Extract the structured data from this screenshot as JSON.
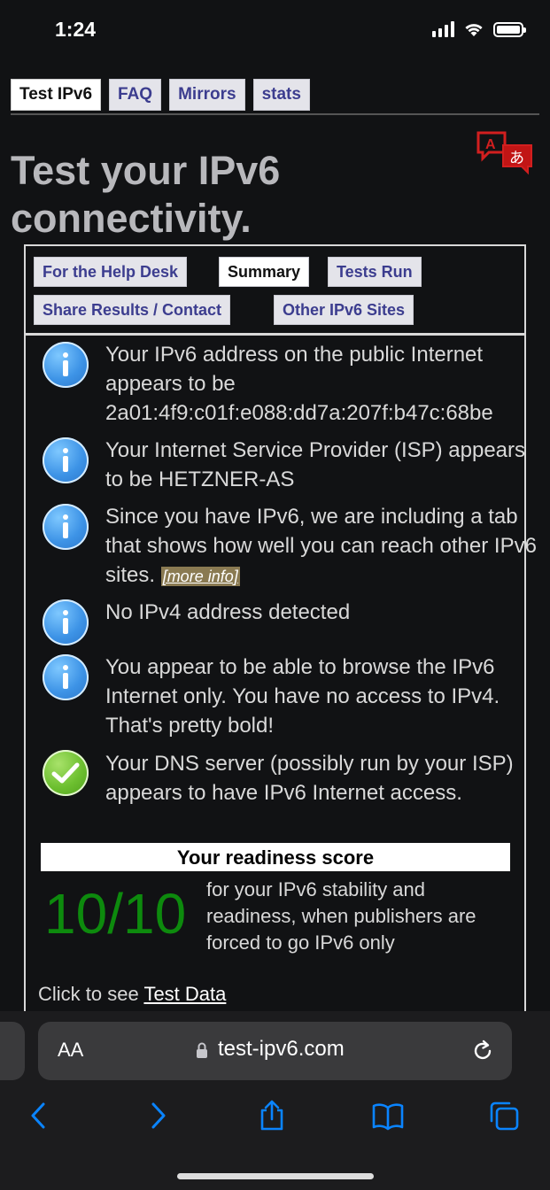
{
  "status": {
    "time": "1:24"
  },
  "nav": {
    "tabs": [
      {
        "label": "Test IPv6",
        "active": true
      },
      {
        "label": "FAQ"
      },
      {
        "label": "Mirrors"
      },
      {
        "label": "stats"
      }
    ]
  },
  "page": {
    "title": "Test your IPv6 connectivity."
  },
  "subnav": {
    "tabs": [
      {
        "label": "For the Help Desk"
      },
      {
        "label": "Summary",
        "active": true
      },
      {
        "label": "Tests Run"
      },
      {
        "label": "Share Results / Contact"
      },
      {
        "label": "Other IPv6 Sites"
      }
    ]
  },
  "results": [
    {
      "icon": "info-icon",
      "text": "Your IPv6 address on the public Internet appears to be 2a01:4f9:c01f:e088:dd7a:207f:b47c:68be"
    },
    {
      "icon": "info-icon",
      "text": "Your Internet Service Provider (ISP) appears to be HETZNER-AS"
    },
    {
      "icon": "info-icon",
      "text": "Since you have IPv6, we are including a tab that shows how well you can reach other IPv6 sites.",
      "link": "[more info]"
    },
    {
      "icon": "info-icon",
      "text": "No IPv4 address detected"
    },
    {
      "icon": "info-icon",
      "text": "You appear to be able to browse the IPv6 Internet only. You have no access to IPv4. That's pretty bold!"
    },
    {
      "icon": "check-icon",
      "text": "Your DNS server (possibly run by your ISP) appears to have IPv6 Internet access."
    }
  ],
  "readiness": {
    "heading": "Your readiness score",
    "score": "10/10",
    "description": "for your IPv6 stability and readiness, when publishers are forced to go IPv6 only"
  },
  "test_data": {
    "prefix": "Click to see",
    "link": "Test Data"
  },
  "browser": {
    "aa_label": "AA",
    "url": "test-ipv6.com"
  },
  "colors": {
    "score_green": "#0d8a0d",
    "tab_text": "#3c3d8f",
    "accent_blue": "#0a84ff"
  }
}
